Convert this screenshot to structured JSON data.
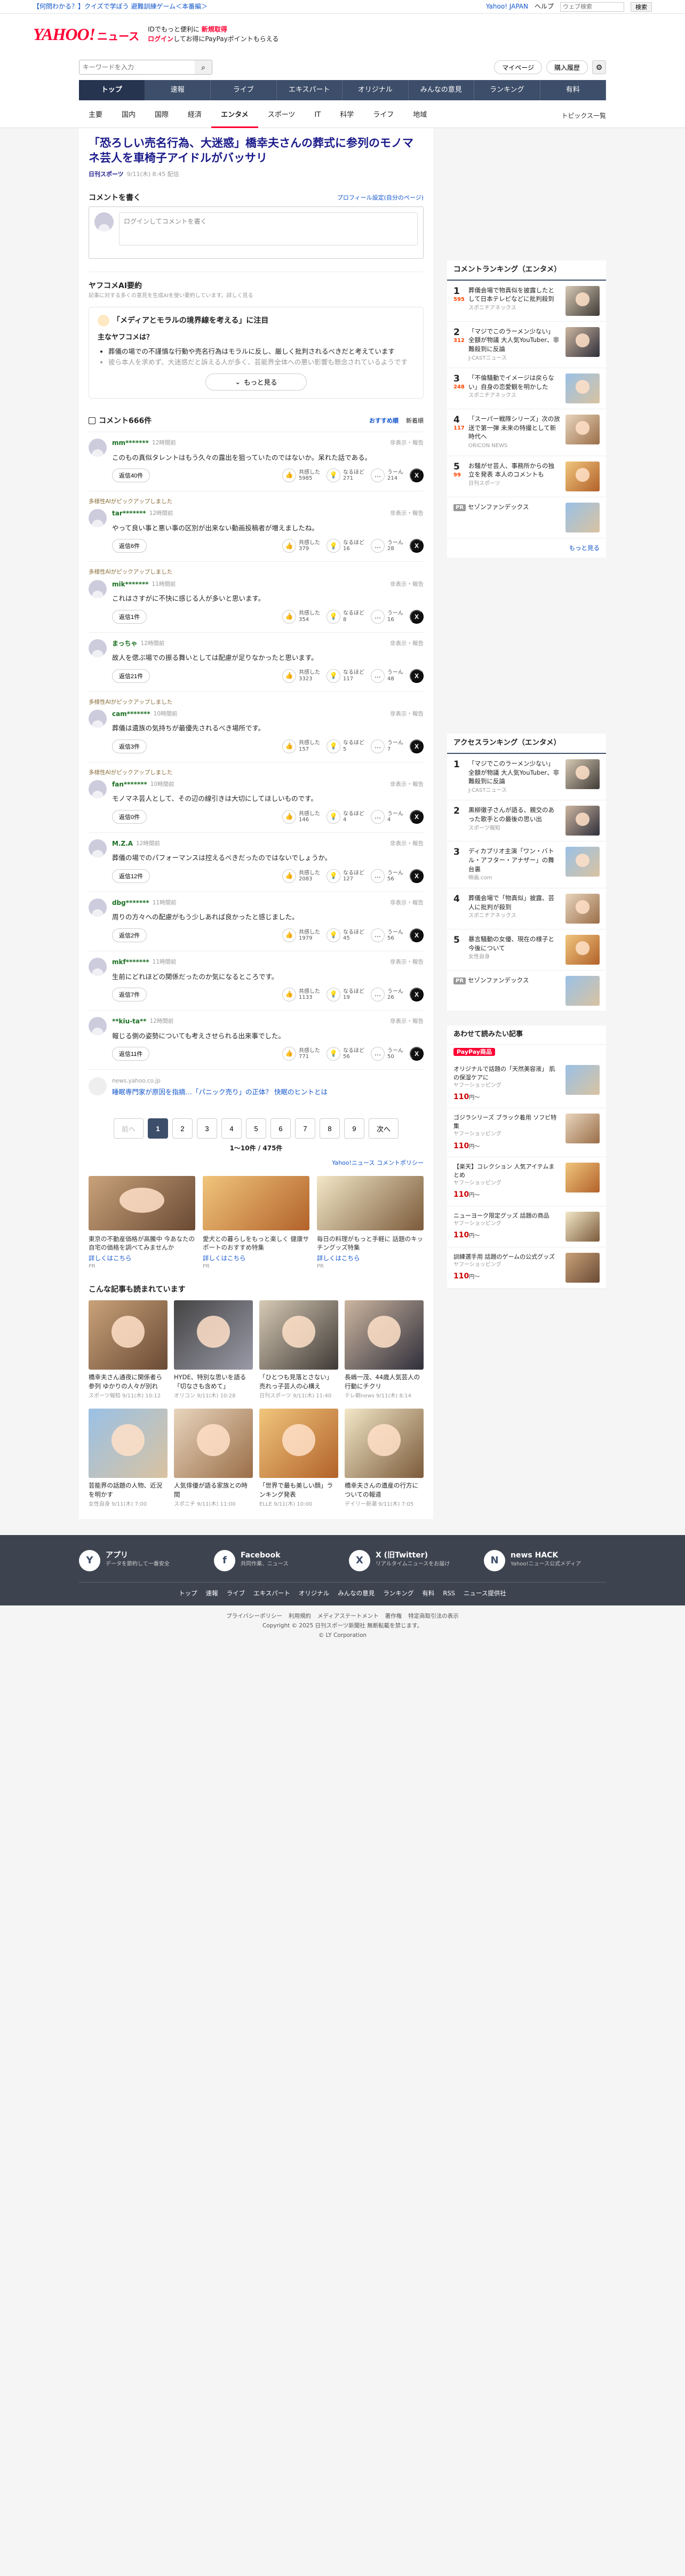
{
  "topbar": {
    "promo": "【何問わかる？】クイズで学ぼう 避難訓練ゲーム＜本番編＞",
    "r": [
      "Yahoo! JAPAN",
      "ヘルプ"
    ],
    "search_ph": "ウェブ検索",
    "search_btn": "検索"
  },
  "header": {
    "logo": "YAHOO!",
    "logo_jp": "JAPAN",
    "section": "ニュース",
    "promo1": "IDでもっと便利に",
    "promo1b": "新規取得",
    "promo2": "ログイン",
    "promo3": "してお得にPayPayポイントもらえる"
  },
  "searchrow": {
    "placeholder": "キーワードを入力",
    "btn1": "マイページ",
    "btn2": "購入履歴"
  },
  "gnav": [
    "トップ",
    "速報",
    "ライブ",
    "エキスパート",
    "オリジナル",
    "みんなの意見",
    "ランキング",
    "有料"
  ],
  "snav": [
    "主要",
    "国内",
    "国際",
    "経済",
    "エンタメ",
    "スポーツ",
    "IT",
    "科学",
    "ライフ",
    "地域"
  ],
  "snav_r": "トピックス一覧",
  "article": {
    "title": "「恐ろしい売名行為、大迷惑」橋幸夫さんの葬式に参列のモノマネ芸人を車椅子アイドルがバッサリ",
    "source": "日刊スポーツ",
    "date": "9/11(木) 8:45 配信"
  },
  "cbox": {
    "title": "コメントを書く",
    "link": "プロフィール設定(自分のページ)",
    "placeholder": "ログインしてコメントを書く"
  },
  "ai": {
    "title": "ヤフコメAI要約",
    "sub": "記事に対する多くの意見を生成AIを使い要約しています。詳しく見る",
    "q": "「メディアとモラルの境界線を考える」に注目",
    "sec": "主なヤフコメは？",
    "items": [
      "葬儀の場での不謹慎な行動や売名行為はモラルに反し、厳しく批判されるべきだと考えています",
      "彼ら本人を求めず、大迷惑だと訴える人が多く、芸能界全体への悪い影響も懸念されているようです"
    ],
    "more": "もっと見る"
  },
  "comm": {
    "title": "コメント666件",
    "sort1": "おすすめ順",
    "sort2": "新着順"
  },
  "comments": [
    {
      "exp": "",
      "user": "mm*******",
      "time": "12時間前",
      "rep": "非表示・報告",
      "text": "このもの真似タレントはもう久々の露出を狙っていたのではないか。呆れた話である。",
      "reply": "返信40件",
      "r1": "共感した",
      "c1": "5985",
      "r2": "なるほど",
      "c2": "271",
      "r3": "うーん",
      "c3": "214"
    },
    {
      "exp": "多様性AIがピックアップしました",
      "user": "tar*******",
      "time": "12時間前",
      "rep": "非表示・報告",
      "text": "やって良い事と悪い事の区別が出来ない動画投稿者が増えましたね。",
      "reply": "返信6件",
      "r1": "共感した",
      "c1": "379",
      "r2": "なるほど",
      "c2": "16",
      "r3": "うーん",
      "c3": "28"
    },
    {
      "exp": "多様性AIがピックアップしました",
      "user": "mik*******",
      "time": "11時間前",
      "rep": "非表示・報告",
      "text": "これはさすがに不快に感じる人が多いと思います。",
      "reply": "返信1件",
      "r1": "共感した",
      "c1": "354",
      "r2": "なるほど",
      "c2": "8",
      "r3": "うーん",
      "c3": "16"
    },
    {
      "exp": "",
      "user": "まっちゃ",
      "time": "12時間前",
      "rep": "非表示・報告",
      "text": "故人を偲ぶ場での振る舞いとしては配慮が足りなかったと思います。",
      "reply": "返信21件",
      "r1": "共感した",
      "c1": "3323",
      "r2": "なるほど",
      "c2": "117",
      "r3": "うーん",
      "c3": "48"
    },
    {
      "exp": "多様性AIがピックアップしました",
      "user": "cam*******",
      "time": "10時間前",
      "rep": "非表示・報告",
      "text": "葬儀は遺族の気持ちが最優先されるべき場所です。",
      "reply": "返信3件",
      "r1": "共感した",
      "c1": "157",
      "r2": "なるほど",
      "c2": "5",
      "r3": "うーん",
      "c3": "7"
    },
    {
      "exp": "多様性AIがピックアップしました",
      "user": "fan*******",
      "time": "10時間前",
      "rep": "非表示・報告",
      "text": "モノマネ芸人として、その辺の線引きは大切にしてほしいものです。",
      "reply": "返信0件",
      "r1": "共感した",
      "c1": "146",
      "r2": "なるほど",
      "c2": "4",
      "r3": "うーん",
      "c3": "4"
    },
    {
      "exp": "",
      "user": "M.Z.A",
      "time": "12時間前",
      "rep": "非表示・報告",
      "text": "葬儀の場でのパフォーマンスは控えるべきだったのではないでしょうか。",
      "reply": "返信12件",
      "r1": "共感した",
      "c1": "2083",
      "r2": "なるほど",
      "c2": "127",
      "r3": "うーん",
      "c3": "56"
    },
    {
      "exp": "",
      "user": "dbg*******",
      "time": "11時間前",
      "rep": "非表示・報告",
      "text": "周りの方々への配慮がもう少しあれば良かったと感じました。",
      "reply": "返信2件",
      "r1": "共感した",
      "c1": "1979",
      "r2": "なるほど",
      "c2": "45",
      "r3": "うーん",
      "c3": "56"
    },
    {
      "exp": "",
      "user": "mkf*******",
      "time": "11時間前",
      "rep": "非表示・報告",
      "text": "生前にどれほどの関係だったのか気になるところです。",
      "reply": "返信7件",
      "r1": "共感した",
      "c1": "1133",
      "r2": "なるほど",
      "c2": "19",
      "r3": "うーん",
      "c3": "26"
    },
    {
      "exp": "",
      "user": "**kiu-ta**",
      "time": "12時間前",
      "rep": "非表示・報告",
      "text": "報じる側の姿勢についても考えさせられる出来事でした。",
      "reply": "返信11件",
      "r1": "共感した",
      "c1": "771",
      "r2": "なるほど",
      "c2": "56",
      "r3": "うーん",
      "c3": "50"
    }
  ],
  "pr": {
    "src": "news.yahoo.co.jp",
    "title": "睡眠専門家が原因を指摘…「パニック売り」の正体？ 快眠のヒントとは"
  },
  "pager": {
    "prev": "前へ",
    "next": "次へ",
    "pages": [
      "1",
      "2",
      "3",
      "4",
      "5",
      "6",
      "7",
      "8",
      "9"
    ],
    "count": "1〜10件 / 475件",
    "policy": "Yahoo!ニュース コメントポリシー"
  },
  "ads": [
    {
      "cap": "東京の不動産価格が高騰中 今あなたの自宅の価格を調べてみませんか",
      "link": "詳しくはこちら",
      "src": "PR"
    },
    {
      "cap": "愛犬との暮らしをもっと楽しく 健康サポートのおすすめ特集",
      "link": "詳しくはこちら",
      "src": "PR"
    },
    {
      "cap": "毎日の料理がもっと手軽に 話題のキッチングッズ特集",
      "link": "詳しくはこちら",
      "src": "PR"
    }
  ],
  "rec": {
    "title": "こんな記事も読まれています",
    "items": [
      {
        "t": "橋幸夫さん通夜に関係者ら参列 ゆかりの人々が別れ",
        "s": "スポーツ報知 9/11(木) 10:12"
      },
      {
        "t": "HYDE、特別な思いを語る「切なさも含めて」",
        "s": "オリコン 9/11(木) 10:28"
      },
      {
        "t": "「ひとつも見落とさない」売れっ子芸人の心構え",
        "s": "日刊スポーツ 9/11(木) 11:40"
      },
      {
        "t": "長嶋一茂、44歳人気芸人の行動にチクリ",
        "s": "テレ朝news 9/11(木) 8:14"
      },
      {
        "t": "芸能界の話題の人物、近況を明かす",
        "s": "女性自身 9/11(木) 7:00"
      },
      {
        "t": "人気俳優が語る家族との時間",
        "s": "スポニチ 9/11(木) 11:00"
      },
      {
        "t": "「世界で最も美しい顔」ランキング発表",
        "s": "ELLE 9/11(木) 10:00"
      },
      {
        "t": "橋幸夫さんの遺産の行方についての報道",
        "s": "デイリー新潮 9/11(木) 7:05"
      }
    ]
  },
  "ranking": {
    "title": "コメントランキング（エンタメ）",
    "items": [
      {
        "n": "1",
        "cnt": "595",
        "t": "葬儀会場で物真似を披露したとして日本テレビなどに批判殺到",
        "s": "スポニチアネックス"
      },
      {
        "n": "2",
        "cnt": "312",
        "t": "「マジでこのラーメン少ない」全額が物議 大人気YouTuber、非難殺到に反論",
        "s": "J-CASTニュース"
      },
      {
        "n": "3",
        "cnt": "248",
        "t": "「不倫騒動でイメージは戻らない」自身の恋愛観を明かした",
        "s": "スポニチアネックス"
      },
      {
        "n": "4",
        "cnt": "117",
        "t": "「スーパー戦隊シリーズ」次の放送で第一弾 未来の特撮として新時代へ",
        "s": "ORICON NEWS"
      },
      {
        "n": "5",
        "cnt": "99",
        "t": "お騒がせ芸人、事務所からの独立を発表 本人のコメントも",
        "s": "日刊スポーツ"
      }
    ],
    "pr": "PR",
    "pr_t": "セゾンファンデックス",
    "more": "もっと見る"
  },
  "access": {
    "title": "アクセスランキング（エンタメ）",
    "items": [
      {
        "n": "1",
        "t": "「マジでこのラーメン少ない」全額が物議 大人気YouTuber、非難殺到に反論",
        "s": "J-CASTニュース"
      },
      {
        "n": "2",
        "t": "黒柳徹子さんが語る、親交のあった歌手との最後の思い出",
        "s": "スポーツ報知"
      },
      {
        "n": "3",
        "t": "ディカプリオ主演「ワン・バトル・アフター・アナザー」の舞台裏",
        "s": "映画.com"
      },
      {
        "n": "4",
        "t": "葬儀会場で「物真似」披露、芸人に批判が殺到",
        "s": "スポニチアネックス"
      },
      {
        "n": "5",
        "t": "暴言騒動の女優、現在の様子と今後について",
        "s": "女性自身"
      }
    ],
    "pr": "PR",
    "pr_t": "セゾンファンデックス"
  },
  "shop": {
    "title": "あわせて読みたい記事",
    "sub": "PayPay商品",
    "items": [
      {
        "t": "オリジナルで話題の「天然美容液」 肌の保湿ケアに",
        "s": "ヤフーショッピング",
        "p": "110",
        "u": "円〜"
      },
      {
        "t": "ゴジラシリーズ ブラック着用 ソフビ特集",
        "s": "ヤフーショッピング",
        "p": "110",
        "u": "円〜"
      },
      {
        "t": "【楽天】コレクション 人気アイテムまとめ",
        "s": "ヤフーショッピング",
        "p": "110",
        "u": "円〜"
      },
      {
        "t": "ニューヨーク限定グッズ 話題の商品",
        "s": "ヤフーショッピング",
        "p": "110",
        "u": "円〜"
      },
      {
        "t": "訓練選手用 話題のゲームの公式グッズ",
        "s": "ヤフーショッピング",
        "p": "110",
        "u": "円〜"
      }
    ]
  },
  "footer": {
    "apps": [
      {
        "ic": "Y",
        "t": "アプリ",
        "d": "データを節約して一番安全"
      },
      {
        "ic": "f",
        "t": "Facebook",
        "d": "共同作業、ニュース"
      },
      {
        "ic": "X",
        "t": "X (旧Twitter)",
        "d": "リアルタイムニュースをお届け"
      },
      {
        "ic": "N",
        "t": "news HACK",
        "d": "Yahoo!ニュース公式メディア"
      }
    ],
    "links": [
      "トップ",
      "速報",
      "ライブ",
      "エキスパート",
      "オリジナル",
      "みんなの意見",
      "ランキング",
      "有料",
      "RSS",
      "ニュース提供社"
    ],
    "legal": [
      "プライバシーポリシー",
      "利用規約",
      "メディアステートメント",
      "著作権",
      "特定商取引法の表示"
    ],
    "copy": "Copyright © 2025 日刊スポーツ新聞社 無断転載を禁じます。",
    "copy2": "© LY Corporation"
  }
}
